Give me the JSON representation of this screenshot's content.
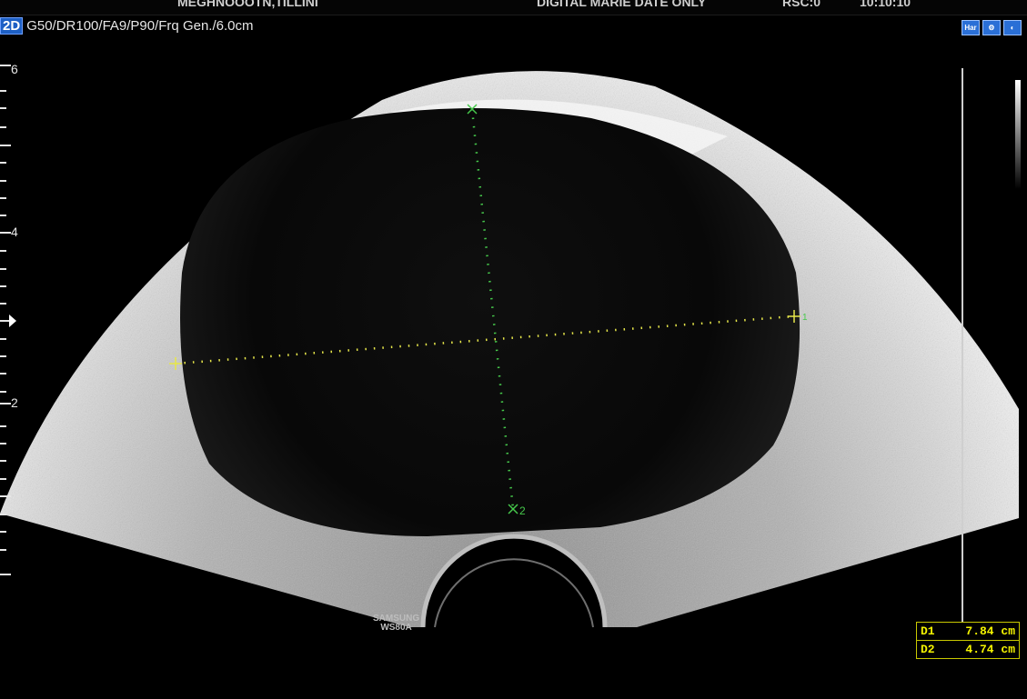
{
  "header": {
    "patient_text": "MEGHNOOOTN,TILLINI",
    "center_text": "DIGITAL MARIE DATE ONLY",
    "right_text_1": "RSC:0",
    "right_text_2": "10:10:10"
  },
  "params": {
    "mode": "2D",
    "settings": "G50/DR100/FA9/P90/Frq Gen./6.0cm"
  },
  "top_icons": [
    "Har",
    "gear-icon",
    "probe-icon"
  ],
  "depth_ruler": {
    "labels": [
      "6",
      "4",
      "2"
    ]
  },
  "calipers": [
    {
      "id": "1",
      "color": "#e6e64a",
      "style": "dotted"
    },
    {
      "id": "2",
      "color": "#46c84b",
      "style": "dotted"
    }
  ],
  "probe": {
    "brand": "SAMSUNG",
    "model": "WS80A"
  },
  "measurements": [
    {
      "label": "D1",
      "value": "7.84 cm"
    },
    {
      "label": "D2",
      "value": "4.74 cm"
    }
  ],
  "colors": {
    "caliper1": "#e6e64a",
    "caliper2": "#46c84b",
    "result_text": "#f4f400",
    "mode_badge": "#1d5fc4"
  }
}
